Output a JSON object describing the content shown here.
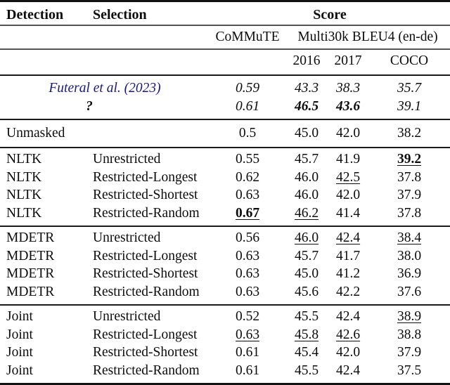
{
  "table": {
    "headers": {
      "detection": "Detection",
      "selection": "Selection",
      "score": "Score",
      "commute": "CoMMuTE",
      "multi30k": "Multi30k BLEU4 (en-de)",
      "y2016": "2016",
      "y2017": "2017",
      "coco": "COCO"
    },
    "colors": {
      "citation_link": "#1a1a7a",
      "rule_dark": "#121212",
      "rule_light": "#555555",
      "text": "#0d0d0d"
    },
    "reference_rows": [
      {
        "detection": "Futeral et al. (2023)",
        "detection_style": "citation",
        "selection": "",
        "commute": "0.59",
        "y2016": "43.3",
        "y2017": "38.3",
        "coco": "35.7",
        "styles": {
          "commute": "italic",
          "y2016": "italic",
          "y2017": "italic",
          "coco": "italic"
        }
      },
      {
        "detection": "?",
        "detection_style": "qmark",
        "selection": "",
        "commute": "0.61",
        "y2016": "46.5",
        "y2017": "43.6",
        "coco": "39.1",
        "styles": {
          "commute": "italic",
          "y2016": "italic bold",
          "y2017": "italic bold",
          "coco": "italic"
        }
      }
    ],
    "baseline_rows": [
      {
        "detection": "Unmasked",
        "selection": "",
        "commute": "0.5",
        "y2016": "45.0",
        "y2017": "42.0",
        "coco": "38.2",
        "styles": {
          "commute": "",
          "y2016": "",
          "y2017": "",
          "coco": ""
        }
      }
    ],
    "groups": [
      {
        "name": "NLTK",
        "rows": [
          {
            "detection": "NLTK",
            "selection": "Unrestricted",
            "commute": "0.55",
            "y2016": "45.7",
            "y2017": "41.9",
            "coco": "39.2",
            "styles": {
              "commute": "",
              "y2016": "",
              "y2017": "",
              "coco": "bold uline"
            }
          },
          {
            "detection": "NLTK",
            "selection": "Restricted-Longest",
            "commute": "0.62",
            "y2016": "46.0",
            "y2017": "42.5",
            "coco": "37.8",
            "styles": {
              "commute": "",
              "y2016": "",
              "y2017": "uline",
              "coco": ""
            }
          },
          {
            "detection": "NLTK",
            "selection": "Restricted-Shortest",
            "commute": "0.63",
            "y2016": "46.0",
            "y2017": "42.0",
            "coco": "37.9",
            "styles": {
              "commute": "",
              "y2016": "",
              "y2017": "",
              "coco": ""
            }
          },
          {
            "detection": "NLTK",
            "selection": "Restricted-Random",
            "commute": "0.67",
            "y2016": "46.2",
            "y2017": "41.4",
            "coco": "37.8",
            "styles": {
              "commute": "bold uline",
              "y2016": "uline",
              "y2017": "",
              "coco": ""
            }
          }
        ]
      },
      {
        "name": "MDETR",
        "rows": [
          {
            "detection": "MDETR",
            "selection": "Unrestricted",
            "commute": "0.56",
            "y2016": "46.0",
            "y2017": "42.4",
            "coco": "38.4",
            "styles": {
              "commute": "",
              "y2016": "uline",
              "y2017": "uline",
              "coco": "uline"
            }
          },
          {
            "detection": "MDETR",
            "selection": "Restricted-Longest",
            "commute": "0.63",
            "y2016": "45.7",
            "y2017": "41.7",
            "coco": "38.0",
            "styles": {
              "commute": "",
              "y2016": "",
              "y2017": "",
              "coco": ""
            }
          },
          {
            "detection": "MDETR",
            "selection": "Restricted-Shortest",
            "commute": "0.63",
            "y2016": "45.0",
            "y2017": "41.2",
            "coco": "36.9",
            "styles": {
              "commute": "",
              "y2016": "",
              "y2017": "",
              "coco": ""
            }
          },
          {
            "detection": "MDETR",
            "selection": "Restricted-Random",
            "commute": "0.63",
            "y2016": "45.6",
            "y2017": "42.2",
            "coco": "37.6",
            "styles": {
              "commute": "",
              "y2016": "",
              "y2017": "",
              "coco": ""
            }
          }
        ]
      },
      {
        "name": "Joint",
        "rows": [
          {
            "detection": "Joint",
            "selection": "Unrestricted",
            "commute": "0.52",
            "y2016": "45.5",
            "y2017": "42.4",
            "coco": "38.9",
            "styles": {
              "commute": "",
              "y2016": "",
              "y2017": "",
              "coco": "uline"
            }
          },
          {
            "detection": "Joint",
            "selection": "Restricted-Longest",
            "commute": "0.63",
            "y2016": "45.8",
            "y2017": "42.6",
            "coco": "38.8",
            "styles": {
              "commute": "uline",
              "y2016": "uline",
              "y2017": "uline",
              "coco": ""
            }
          },
          {
            "detection": "Joint",
            "selection": "Restricted-Shortest",
            "commute": "0.61",
            "y2016": "45.4",
            "y2017": "42.0",
            "coco": "37.9",
            "styles": {
              "commute": "",
              "y2016": "",
              "y2017": "",
              "coco": ""
            }
          },
          {
            "detection": "Joint",
            "selection": "Restricted-Random",
            "commute": "0.61",
            "y2016": "45.5",
            "y2017": "42.4",
            "coco": "37.5",
            "styles": {
              "commute": "",
              "y2016": "",
              "y2017": "",
              "coco": ""
            }
          }
        ]
      }
    ]
  }
}
